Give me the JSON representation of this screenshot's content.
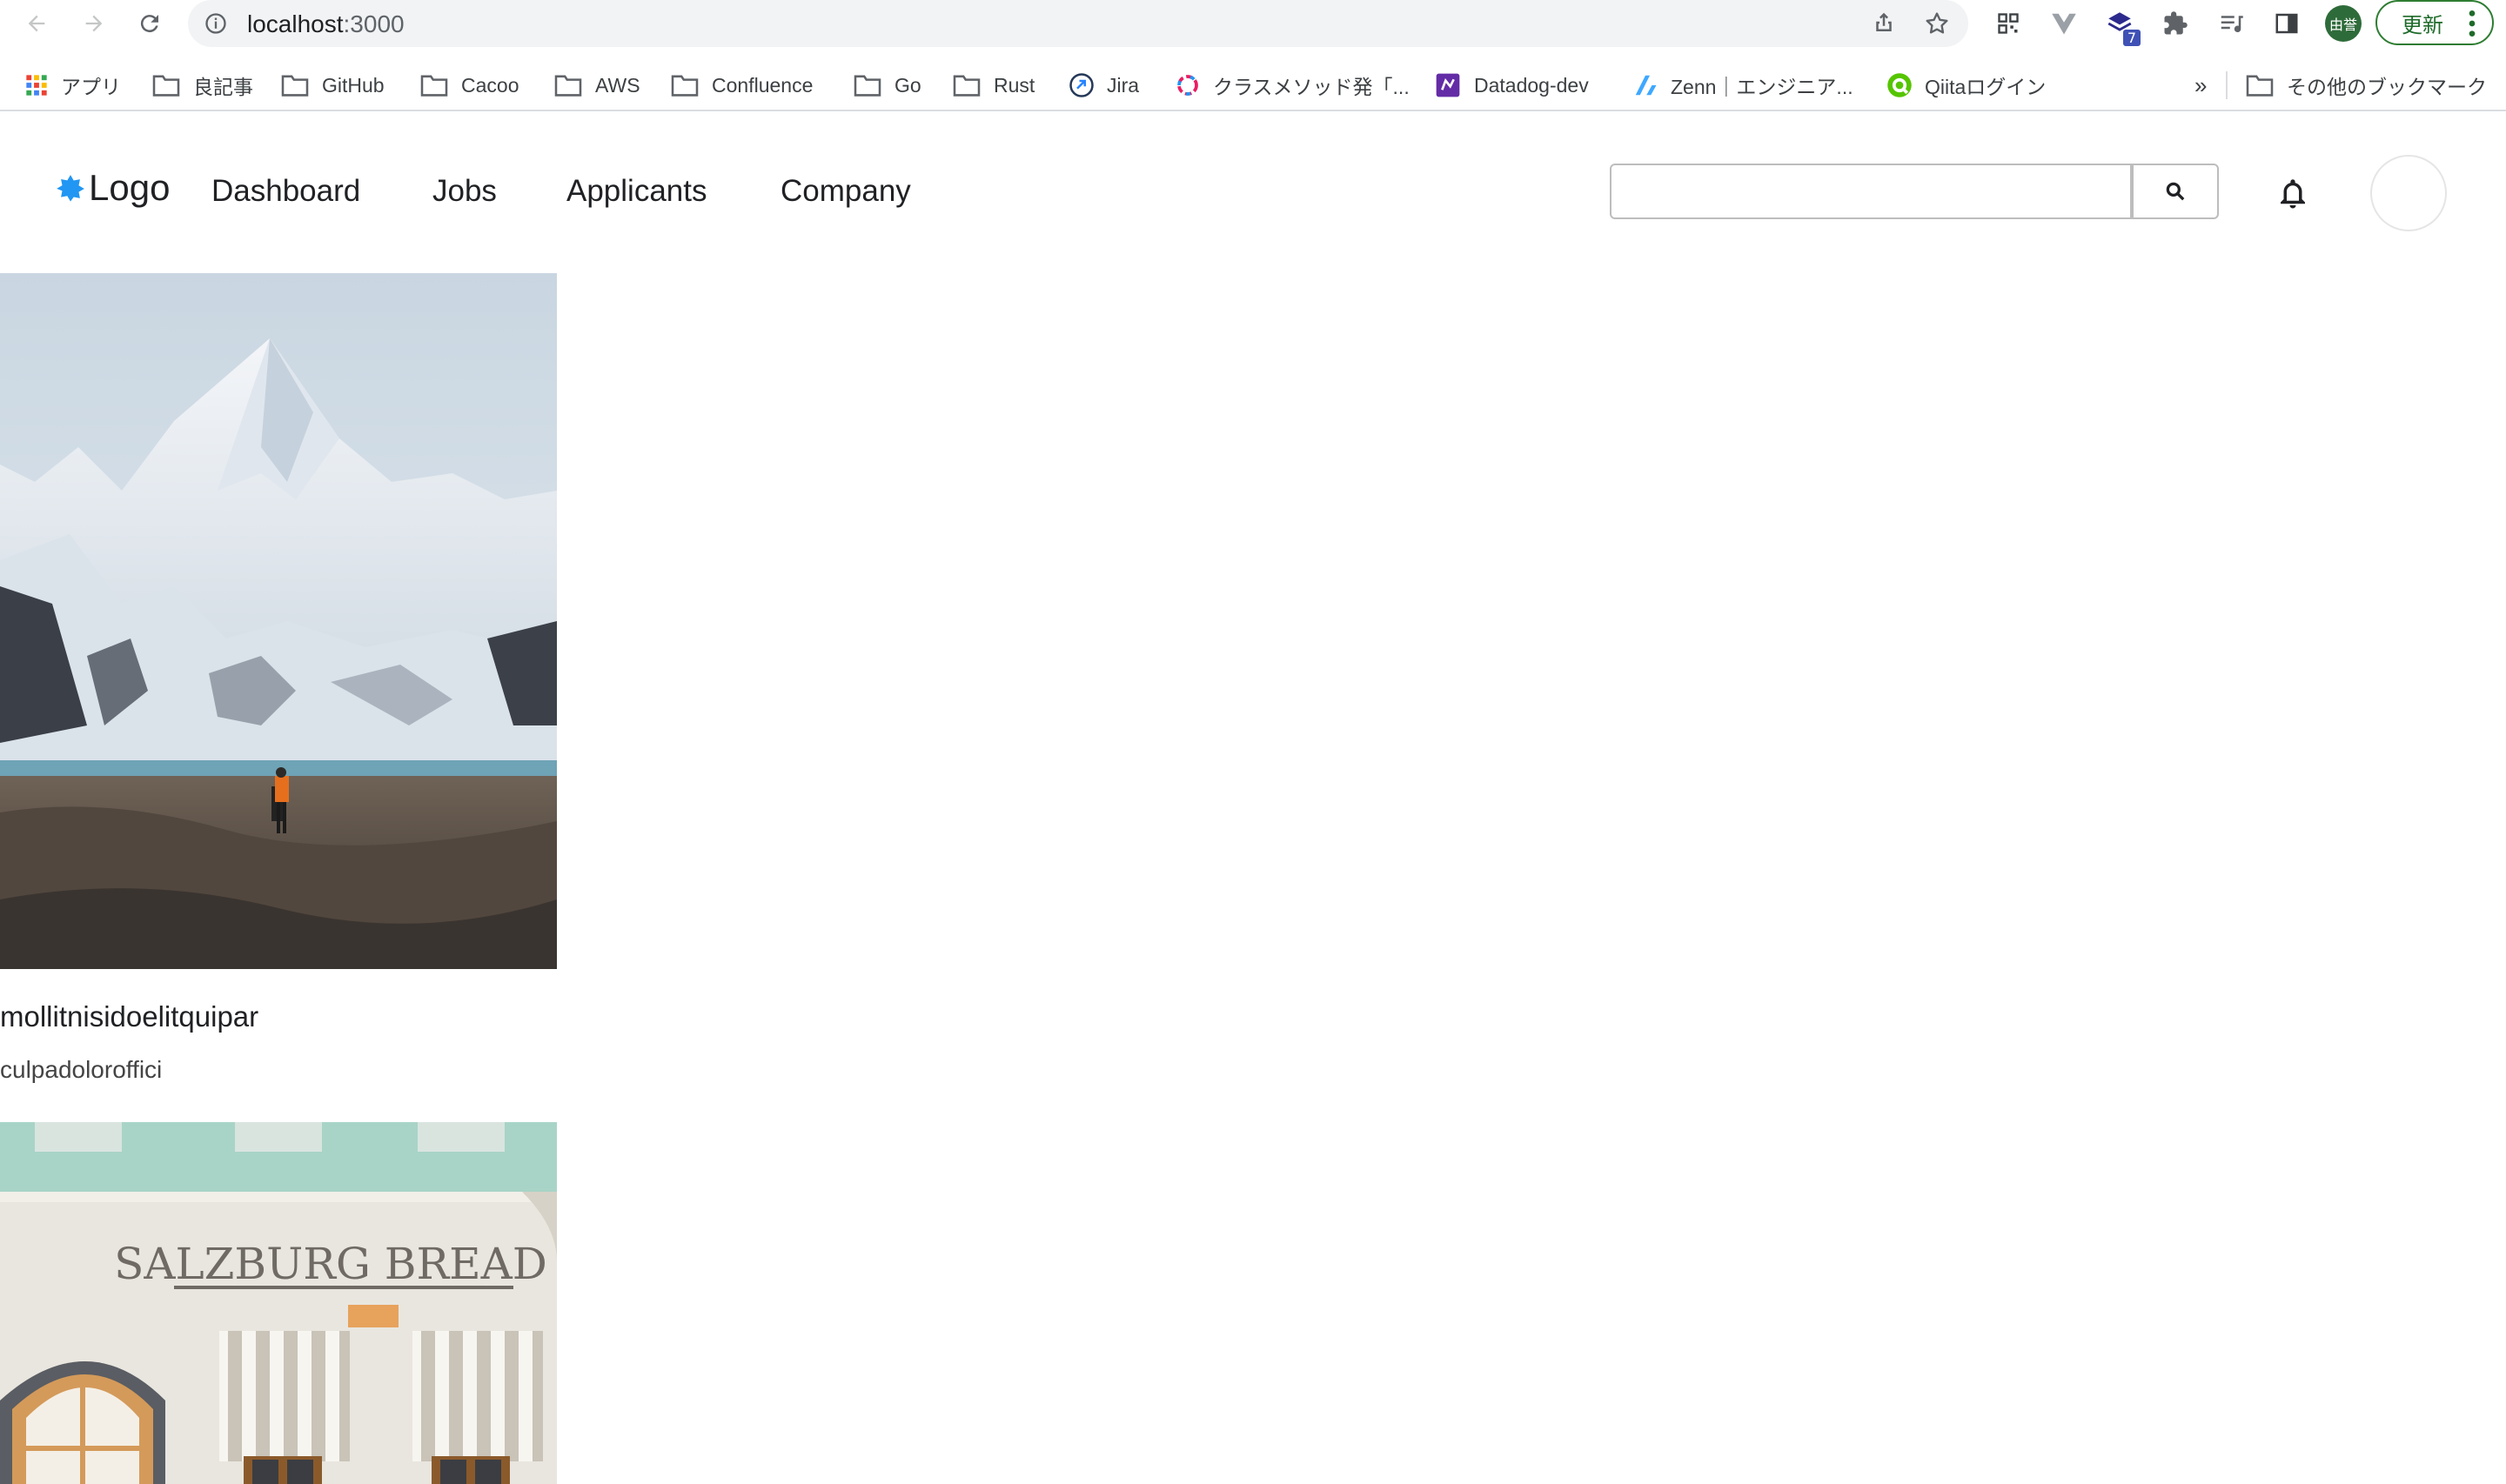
{
  "browser": {
    "url_host": "localhost",
    "url_port": ":3000",
    "profile_initials": "由誉",
    "update_label": "更新",
    "extension_badge": "7"
  },
  "bookmarks": {
    "items": [
      {
        "label": "アプリ",
        "icon": "apps-grid-icon"
      },
      {
        "label": "良記事",
        "icon": "folder-icon"
      },
      {
        "label": "GitHub",
        "icon": "folder-icon"
      },
      {
        "label": "Cacoo",
        "icon": "folder-icon"
      },
      {
        "label": "AWS",
        "icon": "folder-icon"
      },
      {
        "label": "Confluence",
        "icon": "folder-icon"
      },
      {
        "label": "Go",
        "icon": "folder-icon"
      },
      {
        "label": "Rust",
        "icon": "folder-icon"
      },
      {
        "label": "Jira",
        "icon": "jira-icon"
      },
      {
        "label": "クラスメソッド発「...",
        "icon": "classmethod-icon"
      },
      {
        "label": "Datadog-dev",
        "icon": "datadog-icon"
      },
      {
        "label": "Zenn｜エンジニア...",
        "icon": "zenn-icon"
      },
      {
        "label": "Qiitaログイン",
        "icon": "qiita-icon"
      }
    ],
    "overflow_label": "»",
    "other_bookmarks_label": "その他のブックマーク"
  },
  "header": {
    "logo_text": "Logo",
    "nav": [
      "Dashboard",
      "Jobs",
      "Applicants",
      "Company"
    ],
    "search_value": "",
    "search_placeholder": ""
  },
  "cards": [
    {
      "title": "mollitnisidoelitquipar",
      "subtitle": "culpadoloroffici",
      "image": "mountain-glacier-photo"
    },
    {
      "title": "",
      "subtitle": "",
      "image": "salzburg-bread-storefront-photo",
      "sign_text": "SALZBURG BREAD"
    }
  ],
  "colors": {
    "logo_accent": "#2196f3",
    "update_green": "#2e7d32"
  }
}
